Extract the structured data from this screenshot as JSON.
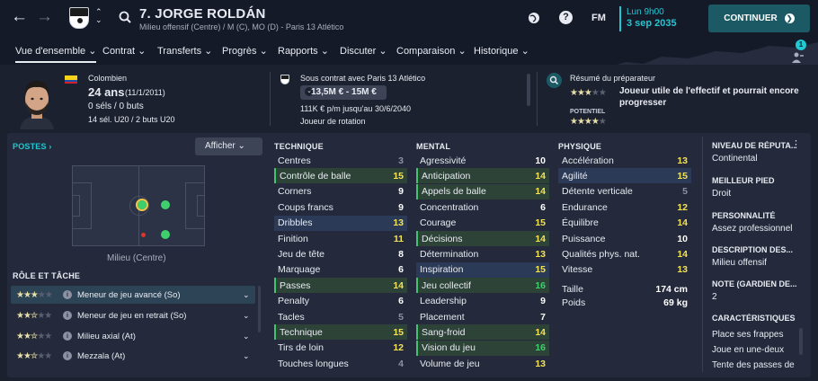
{
  "header": {
    "title": "7. JORGE ROLDÁN",
    "subtitle": "Milieu offensif (Centre) / M (C), MO (D) - Paris 13 Atlético",
    "fm_label": "FM",
    "time": "Lun 9h00",
    "date": "3 sep 2035",
    "continue_label": "CONTINUER",
    "notification_count": "1"
  },
  "menu": [
    {
      "label": "Vue d'ensemble ⌄",
      "active": true
    },
    {
      "label": "Contrat ⌄"
    },
    {
      "label": "Transferts ⌄"
    },
    {
      "label": "Progrès ⌄"
    },
    {
      "label": "Rapports ⌄"
    },
    {
      "label": "Discuter ⌄"
    },
    {
      "label": "Comparaison ⌄"
    },
    {
      "label": "Historique ⌄"
    }
  ],
  "player": {
    "nationality": "Colombien",
    "age": "24 ans",
    "dob": "(11/1/2011)",
    "caps": "0 séls / 0 buts",
    "youth": "14 sél. U20 / 2 buts U20"
  },
  "contract": {
    "status": "Sous contrat avec Paris 13 Atlético",
    "value": "13,5M € - 15M €",
    "wage": "111K € p/m jusqu'au 30/6/2040",
    "role": "Joueur de rotation"
  },
  "coach": {
    "label": "Résumé du préparateur",
    "summary": "Joueur utile de l'effectif et pourrait encore progresser",
    "potential_label": "POTENTIEL",
    "current_stars": 3,
    "potential_stars": 4
  },
  "positions": {
    "header": "POSTES ›",
    "show_label": "Afficher ⌄",
    "position_label": "Milieu (Centre)"
  },
  "roles": {
    "header": "RÔLE ET TÂCHE",
    "items": [
      {
        "label": "Meneur de jeu avancé (So)",
        "stars": 3
      },
      {
        "label": "Meneur de jeu en retrait (So)",
        "stars": 2.5
      },
      {
        "label": "Milieu axial (At)",
        "stars": 2.5
      },
      {
        "label": "Mezzala (At)",
        "stars": 2.5
      }
    ]
  },
  "technique": {
    "header": "TECHNIQUE",
    "rows": [
      {
        "name": "Centres",
        "value": "3",
        "style": "",
        "color": "g"
      },
      {
        "name": "Contrôle de balle",
        "value": "15",
        "style": "green",
        "color": "y"
      },
      {
        "name": "Corners",
        "value": "9",
        "style": "",
        "color": "w"
      },
      {
        "name": "Coups francs",
        "value": "9",
        "style": "",
        "color": "w"
      },
      {
        "name": "Dribbles",
        "value": "13",
        "style": "blue",
        "color": "y"
      },
      {
        "name": "Finition",
        "value": "11",
        "style": "",
        "color": "y"
      },
      {
        "name": "Jeu de tête",
        "value": "8",
        "style": "",
        "color": "w"
      },
      {
        "name": "Marquage",
        "value": "6",
        "style": "",
        "color": "w"
      },
      {
        "name": "Passes",
        "value": "14",
        "style": "green",
        "color": "y"
      },
      {
        "name": "Penalty",
        "value": "6",
        "style": "",
        "color": "w"
      },
      {
        "name": "Tacles",
        "value": "5",
        "style": "",
        "color": "g"
      },
      {
        "name": "Technique",
        "value": "15",
        "style": "green",
        "color": "y"
      },
      {
        "name": "Tirs de loin",
        "value": "12",
        "style": "",
        "color": "y"
      },
      {
        "name": "Touches longues",
        "value": "4",
        "style": "",
        "color": "g"
      }
    ]
  },
  "mental": {
    "header": "MENTAL",
    "rows": [
      {
        "name": "Agressivité",
        "value": "10",
        "style": "",
        "color": "w"
      },
      {
        "name": "Anticipation",
        "value": "14",
        "style": "green",
        "color": "y"
      },
      {
        "name": "Appels de balle",
        "value": "14",
        "style": "green",
        "color": "y"
      },
      {
        "name": "Concentration",
        "value": "6",
        "style": "",
        "color": "w"
      },
      {
        "name": "Courage",
        "value": "15",
        "style": "",
        "color": "y"
      },
      {
        "name": "Décisions",
        "value": "14",
        "style": "green",
        "color": "y"
      },
      {
        "name": "Détermination",
        "value": "13",
        "style": "",
        "color": "y"
      },
      {
        "name": "Inspiration",
        "value": "15",
        "style": "blue",
        "color": "y"
      },
      {
        "name": "Jeu collectif",
        "value": "16",
        "style": "green",
        "color": "gr"
      },
      {
        "name": "Leadership",
        "value": "9",
        "style": "",
        "color": "w"
      },
      {
        "name": "Placement",
        "value": "7",
        "style": "",
        "color": "w"
      },
      {
        "name": "Sang-froid",
        "value": "14",
        "style": "green",
        "color": "y"
      },
      {
        "name": "Vision du jeu",
        "value": "16",
        "style": "green",
        "color": "gr"
      },
      {
        "name": "Volume de jeu",
        "value": "13",
        "style": "",
        "color": "y"
      }
    ]
  },
  "physique": {
    "header": "PHYSIQUE",
    "rows": [
      {
        "name": "Accélération",
        "value": "13",
        "style": "",
        "color": "y"
      },
      {
        "name": "Agilité",
        "value": "15",
        "style": "blue",
        "color": "y"
      },
      {
        "name": "Détente verticale",
        "value": "5",
        "style": "",
        "color": "g"
      },
      {
        "name": "Endurance",
        "value": "12",
        "style": "",
        "color": "y"
      },
      {
        "name": "Équilibre",
        "value": "14",
        "style": "",
        "color": "y"
      },
      {
        "name": "Puissance",
        "value": "10",
        "style": "",
        "color": "w"
      },
      {
        "name": "Qualités phys. nat.",
        "value": "14",
        "style": "",
        "color": "y"
      },
      {
        "name": "Vitesse",
        "value": "13",
        "style": "",
        "color": "y"
      }
    ],
    "height_label": "Taille",
    "height": "174 cm",
    "weight_label": "Poids",
    "weight": "69 kg"
  },
  "sidebar": [
    {
      "h": "NIVEAU DE RÉPUTA...",
      "v": "Continental"
    },
    {
      "h": "MEILLEUR PIED",
      "v": "Droit"
    },
    {
      "h": "PERSONNALITÉ",
      "v": "Assez professionnel"
    },
    {
      "h": "DESCRIPTION DES...",
      "v": "Milieu offensif"
    },
    {
      "h": "NOTE (GARDIEN DE...",
      "v": "2"
    },
    {
      "h": "CARACTÉRISTIQUES JO",
      "v": "Place ses frappes"
    }
  ],
  "traits_more": [
    "Joue en une-deux",
    "Tente des passes de"
  ],
  "colors": {
    "accent": "#21c7d1",
    "green": "#42c46a",
    "yellow": "#f3e35a",
    "bg": "#1c2130",
    "panel": "#242a3b"
  }
}
